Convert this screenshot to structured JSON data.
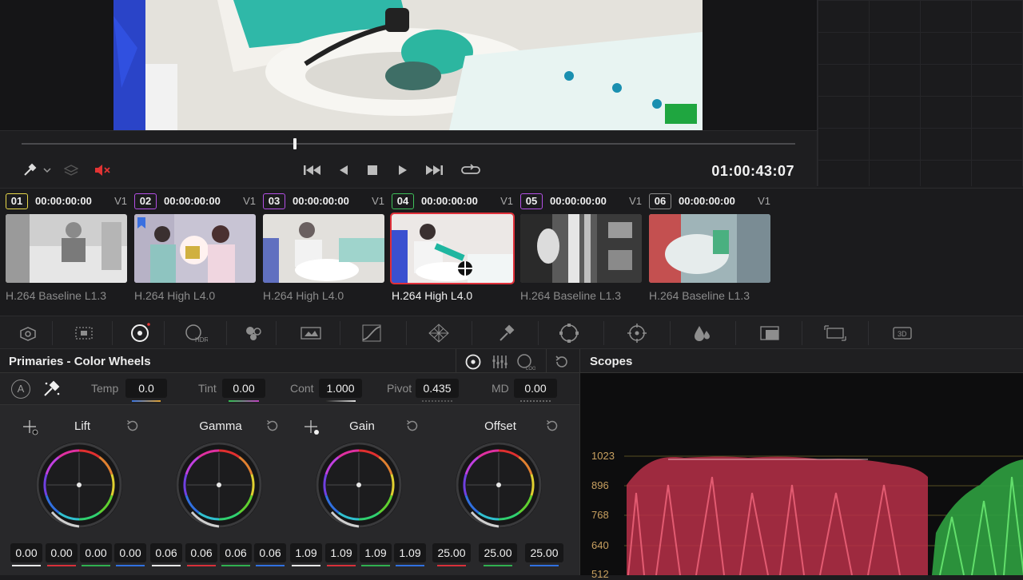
{
  "viewer": {
    "timecode": "01:00:43:07"
  },
  "transport": {
    "buttons": [
      "go-to-start",
      "step-back",
      "stop",
      "play",
      "go-to-end",
      "loop"
    ]
  },
  "clips": [
    {
      "num": "01",
      "tc": "00:00:00:00",
      "track": "V1",
      "codec": "H.264 Baseline L1.3",
      "color": "#e8d84a"
    },
    {
      "num": "02",
      "tc": "00:00:00:00",
      "track": "V1",
      "codec": "H.264 High L4.0",
      "color": "#b450e6"
    },
    {
      "num": "03",
      "tc": "00:00:00:00",
      "track": "V1",
      "codec": "H.264 High L4.0",
      "color": "#b450e6"
    },
    {
      "num": "04",
      "tc": "00:00:00:00",
      "track": "V1",
      "codec": "H.264 High L4.0",
      "color": "#3ec05a"
    },
    {
      "num": "05",
      "tc": "00:00:00:00",
      "track": "V1",
      "codec": "H.264 Baseline L1.3",
      "color": "#b450e6"
    },
    {
      "num": "06",
      "tc": "00:00:00:00",
      "track": "V1",
      "codec": "H.264 Baseline L1.3",
      "color": "#8a8a8a"
    }
  ],
  "primaries": {
    "title": "Primaries - Color Wheels",
    "auto_label": "A",
    "adjust": [
      {
        "label": "Temp",
        "value": "0.0"
      },
      {
        "label": "Tint",
        "value": "0.00"
      },
      {
        "label": "Cont",
        "value": "1.000"
      },
      {
        "label": "Pivot",
        "value": "0.435"
      },
      {
        "label": "MD",
        "value": "0.00"
      }
    ],
    "wheels": [
      {
        "label": "Lift",
        "values": [
          "0.00",
          "0.00",
          "0.00",
          "0.00"
        ]
      },
      {
        "label": "Gamma",
        "values": [
          "0.06",
          "0.06",
          "0.06",
          "0.06"
        ]
      },
      {
        "label": "Gain",
        "values": [
          "1.09",
          "1.09",
          "1.09",
          "1.09"
        ]
      },
      {
        "label": "Offset",
        "values": [
          "25.00",
          "25.00",
          "25.00"
        ]
      }
    ]
  },
  "scopes": {
    "title": "Scopes",
    "scale": [
      "1023",
      "896",
      "768",
      "640",
      "512"
    ]
  }
}
